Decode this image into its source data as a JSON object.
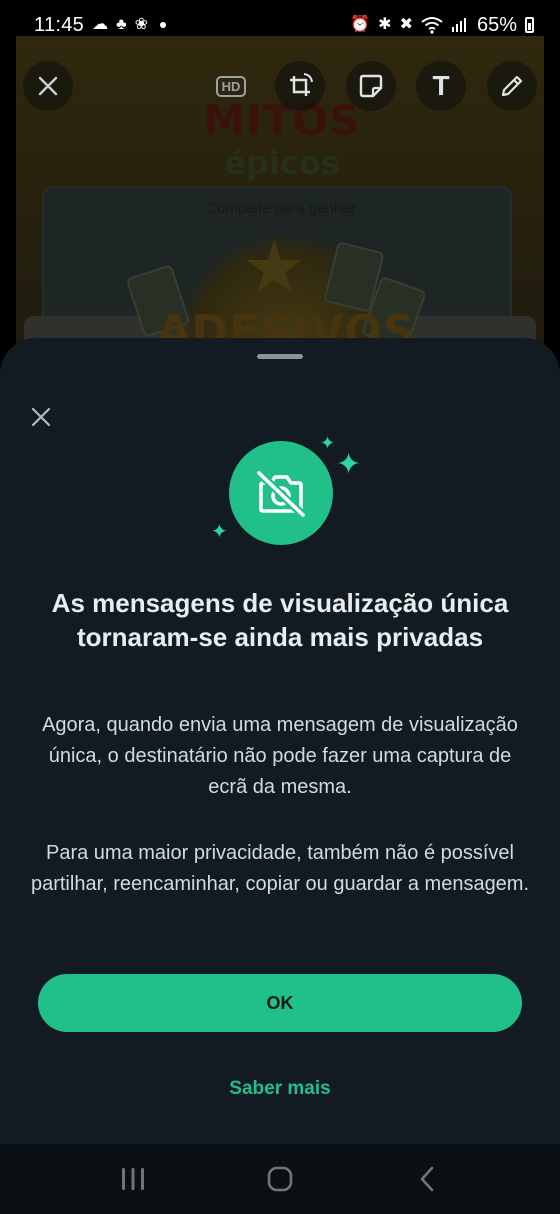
{
  "status_bar": {
    "time": "11:45",
    "left_icons": [
      "cloud-icon",
      "cat-icon",
      "pinwheel-icon",
      "dot-icon"
    ],
    "right_icons": [
      "alarm-icon",
      "bluetooth-icon",
      "mute-icon",
      "wifi-icon",
      "signal-icon"
    ],
    "battery": "65%"
  },
  "editor": {
    "toolbar": [
      "close-icon",
      "hd-icon",
      "crop-rotate-icon",
      "sticker-icon",
      "text-icon",
      "pencil-icon"
    ],
    "hd_label": "HD",
    "text_tool_label": "T",
    "promo": {
      "title": "MITOS",
      "subtitle": "épicos",
      "caption": "Complete para ganhar",
      "banner": "ADESIVOS"
    }
  },
  "sheet": {
    "title": "As mensagens de visualização única tornaram-se ainda mais privadas",
    "paragraph_1": "Agora, quando envia uma mensagem de visualização única, o destinatário não pode fazer uma captura de ecrã da mesma.",
    "paragraph_2": "Para uma maior privacidade, também não é possível partilhar, reencaminhar, copiar ou guardar a mensagem.",
    "ok_label": "OK",
    "learn_more_label": "Saber mais",
    "hero_icon": "no-camera-icon"
  },
  "nav_bar": {
    "buttons": [
      "recent-apps-icon",
      "home-icon",
      "back-icon"
    ]
  },
  "colors": {
    "accent": "#21c08b",
    "sheet_bg": "#121b21",
    "text_primary": "#e9edef"
  }
}
